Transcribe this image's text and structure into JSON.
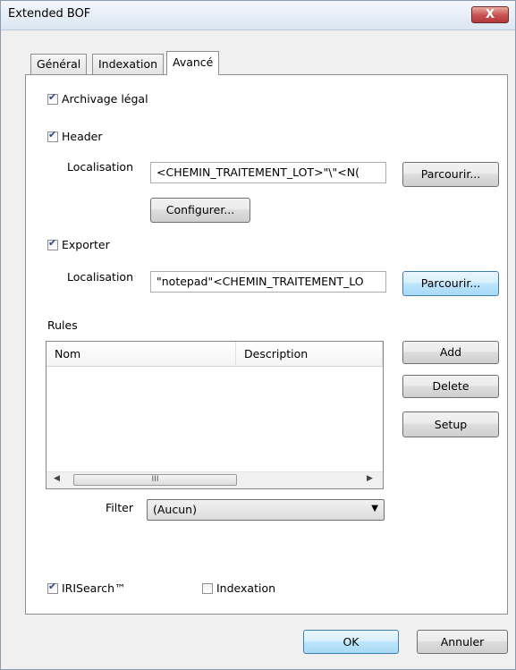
{
  "window": {
    "title": "Extended BOF",
    "close_label": "X"
  },
  "tabs": [
    {
      "label": "Général"
    },
    {
      "label": "Indexation"
    },
    {
      "label": "Avancé"
    }
  ],
  "advanced": {
    "archivage": {
      "label": "Archivage légal",
      "checked": true
    },
    "header": {
      "label": "Header",
      "checked": true,
      "localisation_label": "Localisation",
      "localisation_value": "<CHEMIN_TRAITEMENT_LOT>\"\\\"<N(",
      "browse_label": "Parcourir...",
      "configure_label": "Configurer..."
    },
    "exporter": {
      "label": "Exporter",
      "checked": true,
      "localisation_label": "Localisation",
      "localisation_value": "\"notepad\"<CHEMIN_TRAITEMENT_LO",
      "browse_label": "Parcourir..."
    },
    "rules": {
      "label": "Rules",
      "columns": [
        "Nom",
        "Description"
      ],
      "rows": [],
      "scroll_thumb_label": "III",
      "add_label": "Add",
      "delete_label": "Delete",
      "setup_label": "Setup"
    },
    "filter": {
      "label": "Filter",
      "value": "(Aucun)"
    },
    "irisearch": {
      "label": "IRISearch™",
      "checked": true
    },
    "indexation": {
      "label": "Indexation",
      "checked": false
    }
  },
  "footer": {
    "ok_label": "OK",
    "cancel_label": "Annuler"
  }
}
